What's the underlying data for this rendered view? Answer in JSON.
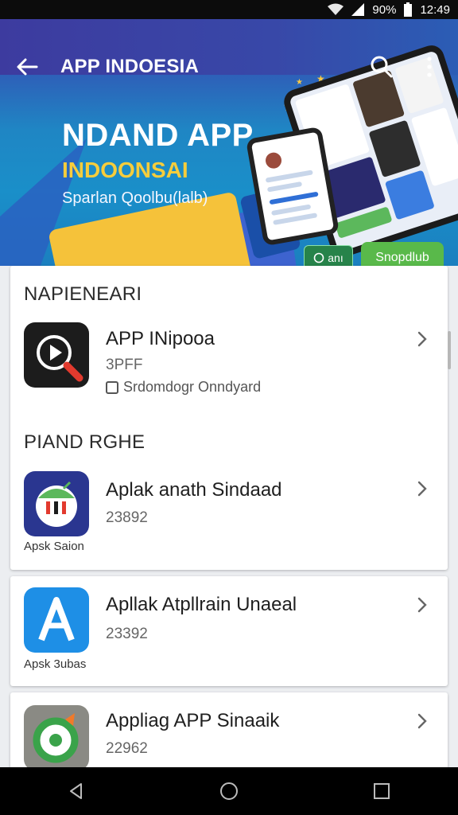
{
  "status_bar": {
    "battery_percent": "90%",
    "time": "12:49"
  },
  "header": {
    "title": "APP INDOESIA"
  },
  "hero": {
    "headline": "NDAND APP",
    "subheadline": "INDOONSAI",
    "tagline": "Sparlan Qoolbu(lalb)",
    "button_secondary_label": "anı",
    "button_primary_label": "Snopdlub",
    "colors": {
      "accent_yellow": "#f6cd3c",
      "accent_green": "#59b94a",
      "brand_blue": "#3848a8"
    }
  },
  "sections": [
    {
      "title": "NAPIENEARI",
      "apps": [
        {
          "name": "APP INipooa",
          "meta": "3PFF",
          "subtitle": "Srdomdogr Onndyard",
          "icon": "video-search-icon",
          "icon_caption": ""
        }
      ]
    },
    {
      "title": "PIAND RGHE",
      "apps": [
        {
          "name": "Aplak anath Sindaad",
          "meta": "23892",
          "icon": "android-robot-icon",
          "icon_caption": "Apsk Saion"
        }
      ]
    }
  ],
  "more_apps": [
    {
      "name": "Apllak Atpllrain Unaeal",
      "meta": "23392",
      "icon": "letter-a-icon",
      "icon_caption": "Apsk 3ubas"
    },
    {
      "name": "Appliag APP Sinaaik",
      "meta": "22962",
      "icon": "green-g-icon",
      "icon_caption": ""
    }
  ]
}
